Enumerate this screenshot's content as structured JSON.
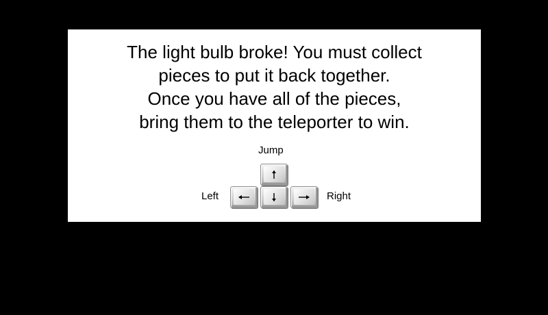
{
  "instructions": {
    "lines": [
      "The light bulb broke! You must collect",
      "pieces to put it back together.",
      "Once you have all of the pieces,",
      "bring them to the teleporter to win."
    ]
  },
  "controls": {
    "jump_label": "Jump",
    "left_label": "Left",
    "right_label": "Right",
    "keys": {
      "up": {
        "icon": "arrow-up-icon",
        "glyph": "🠕"
      },
      "left": {
        "icon": "arrow-left-icon",
        "glyph": "🠔"
      },
      "down": {
        "icon": "arrow-down-icon",
        "glyph": "🠗"
      },
      "right": {
        "icon": "arrow-right-icon",
        "glyph": "🠖"
      }
    }
  },
  "colors": {
    "background": "#000000",
    "panel": "#ffffff",
    "text": "#000000"
  }
}
